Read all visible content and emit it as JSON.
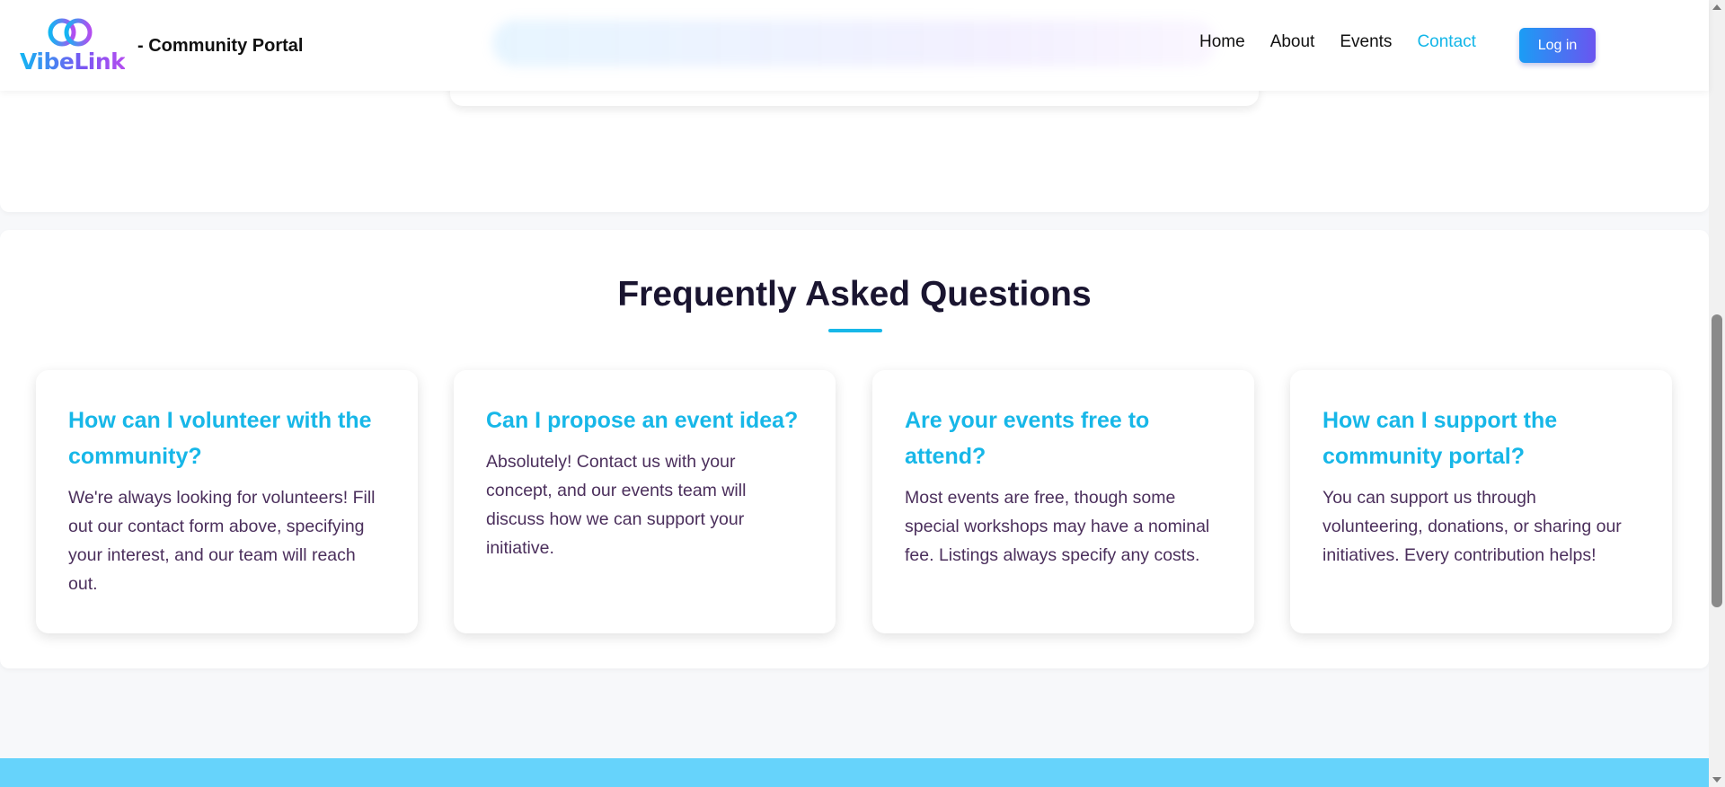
{
  "header": {
    "logo_text": "VibeLink",
    "brand_suffix": "- Community Portal",
    "nav": [
      {
        "label": "Home",
        "active": false
      },
      {
        "label": "About",
        "active": false
      },
      {
        "label": "Events",
        "active": false
      },
      {
        "label": "Contact",
        "active": true
      }
    ],
    "login_label": "Log in"
  },
  "faq": {
    "title": "Frequently Asked Questions",
    "items": [
      {
        "question": "How can I volunteer with the community?",
        "answer": "We're always looking for volunteers! Fill out our contact form above, specifying your interest, and our team will reach out."
      },
      {
        "question": "Can I propose an event idea?",
        "answer": "Absolutely! Contact us with your concept, and our events team will discuss how we can support your initiative."
      },
      {
        "question": "Are your events free to attend?",
        "answer": "Most events are free, though some special workshops may have a nominal fee. Listings always specify any costs."
      },
      {
        "question": "How can I support the community portal?",
        "answer": "You can support us through volunteering, donations, or sharing our initiatives. Every contribution helps!"
      }
    ]
  },
  "colors": {
    "accent": "#17b7e8",
    "heading": "#1a1530",
    "body_text": "#4b2f5c",
    "footer_band": "#66d3fb",
    "button_gradient_start": "#1b9df5",
    "button_gradient_end": "#6a55f0"
  },
  "icons": {
    "logo_mark": "linked-rings-icon"
  }
}
